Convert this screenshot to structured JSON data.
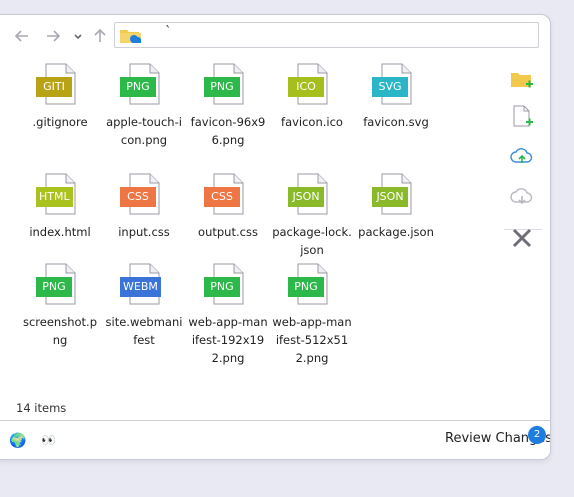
{
  "toolbar": {
    "back_icon": "arrow-left-icon",
    "forward_icon": "arrow-right-icon",
    "history_icon": "chevron-down-icon",
    "up_icon": "arrow-up-icon",
    "address_text": "`"
  },
  "files": [
    {
      "name": ".gitignore",
      "ext": "GITI",
      "color": "#b8a317"
    },
    {
      "name": "apple-touch-icon.png",
      "ext": "PNG",
      "color": "#2db84a"
    },
    {
      "name": "favicon-96x96.png",
      "ext": "PNG",
      "color": "#2db84a"
    },
    {
      "name": "favicon.ico",
      "ext": "ICO",
      "color": "#a6bf1c"
    },
    {
      "name": "favicon.svg",
      "ext": "SVG",
      "color": "#2ab6c6"
    },
    {
      "name": "index.html",
      "ext": "HTML",
      "color": "#a9c21e"
    },
    {
      "name": "input.css",
      "ext": "CSS",
      "color": "#ee7544"
    },
    {
      "name": "output.css",
      "ext": "CSS",
      "color": "#ee7544"
    },
    {
      "name": "package-lock.json",
      "ext": "JSON",
      "color": "#8aba2a"
    },
    {
      "name": "package.json",
      "ext": "JSON",
      "color": "#8aba2a"
    },
    {
      "name": "screenshot.png",
      "ext": "PNG",
      "color": "#2db84a"
    },
    {
      "name": "site.webmanifest",
      "ext": "WEBM",
      "color": "#3b74d8"
    },
    {
      "name": "web-app-manifest-192x192.png",
      "ext": "PNG",
      "color": "#2db84a"
    },
    {
      "name": "web-app-manifest-512x512.png",
      "ext": "PNG",
      "color": "#2db84a"
    }
  ],
  "sidebar_tools": [
    {
      "name": "new-folder-icon"
    },
    {
      "name": "new-file-icon"
    },
    {
      "name": "cloud-upload-icon"
    },
    {
      "name": "cloud-download-icon"
    },
    {
      "name": "close-icon"
    }
  ],
  "status": {
    "item_count": "14 items"
  },
  "footer": {
    "globe_icon": "🌍",
    "eyes_icon": "👀",
    "review_label": "Review Changes",
    "review_count": "2"
  }
}
